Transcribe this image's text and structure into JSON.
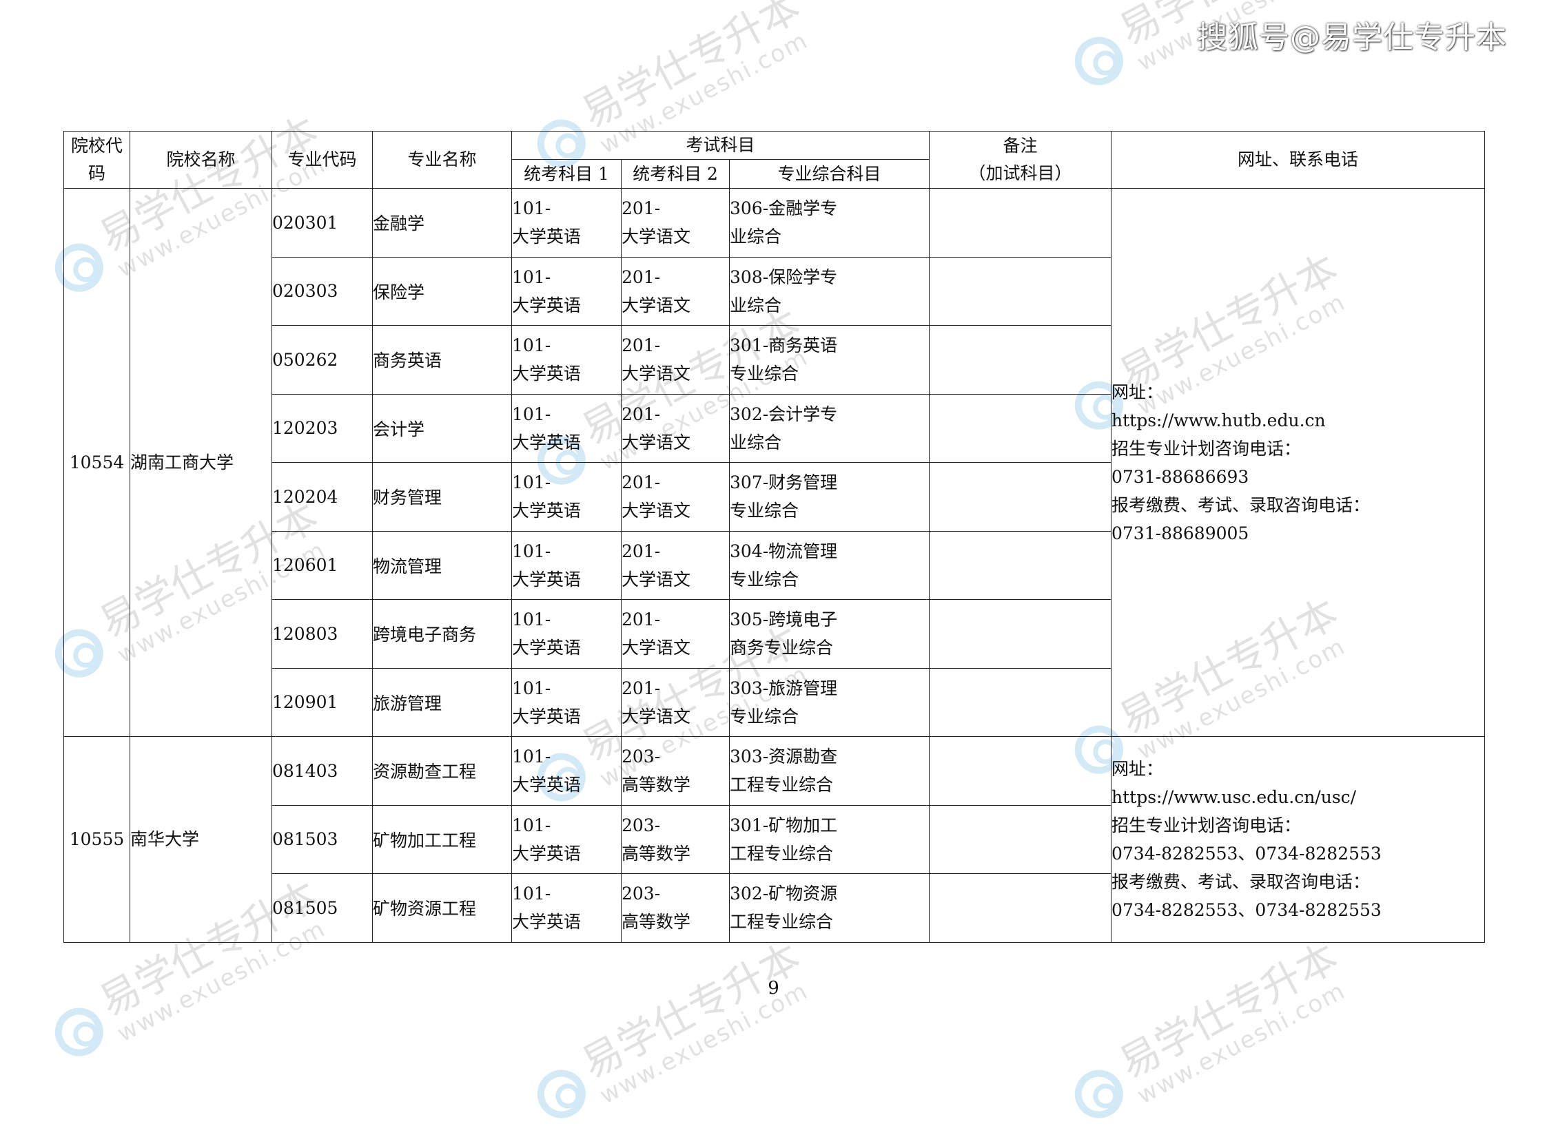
{
  "watermark": {
    "top_right": "搜狐号@易学仕专升本",
    "repeated_cn": "易学仕专升本",
    "repeated_url": "www.exueshi.com",
    "logo_color": "#3aa0d8"
  },
  "table": {
    "headers": {
      "school_code": "院校代码",
      "school_name": "院校名称",
      "major_code": "专业代码",
      "major_name": "专业名称",
      "exam_subjects": "考试科目",
      "subject1": "统考科目 1",
      "subject2": "统考科目 2",
      "subject3": "专业综合科目",
      "note": "备注（加试科目）",
      "note_line1": "备注",
      "note_line2": "（加试科目）",
      "contact": "网址、联系电话"
    },
    "schools": [
      {
        "code": "10554",
        "name": "湖南工商大学",
        "contact_lines": [
          "网址：",
          "https://www.hutb.edu.cn",
          "招生专业计划咨询电话：",
          "0731-88686693",
          "报考缴费、考试、录取咨询电话：",
          "0731-88689005"
        ],
        "majors": [
          {
            "code": "020301",
            "name": "金融学",
            "s1": "101-大学英语",
            "s2": "201-大学语文",
            "s3": "306-金融学专业综合",
            "note": ""
          },
          {
            "code": "020303",
            "name": "保险学",
            "s1": "101-大学英语",
            "s2": "201-大学语文",
            "s3": "308-保险学专业综合",
            "note": ""
          },
          {
            "code": "050262",
            "name": "商务英语",
            "s1": "101-大学英语",
            "s2": "201-大学语文",
            "s3": "301-商务英语专业综合",
            "note": ""
          },
          {
            "code": "120203",
            "name": "会计学",
            "s1": "101-大学英语",
            "s2": "201-大学语文",
            "s3": "302-会计学专业综合",
            "note": ""
          },
          {
            "code": "120204",
            "name": "财务管理",
            "s1": "101-大学英语",
            "s2": "201-大学语文",
            "s3": "307-财务管理专业综合",
            "note": ""
          },
          {
            "code": "120601",
            "name": "物流管理",
            "s1": "101-大学英语",
            "s2": "201-大学语文",
            "s3": "304-物流管理专业综合",
            "note": ""
          },
          {
            "code": "120803",
            "name": "跨境电子商务",
            "s1": "101-大学英语",
            "s2": "201-大学语文",
            "s3": "305-跨境电子商务专业综合",
            "note": ""
          },
          {
            "code": "120901",
            "name": "旅游管理",
            "s1": "101-大学英语",
            "s2": "201-大学语文",
            "s3": "303-旅游管理专业综合",
            "note": ""
          }
        ]
      },
      {
        "code": "10555",
        "name": "南华大学",
        "contact_lines": [
          "网址：",
          "https://www.usc.edu.cn/usc/",
          "招生专业计划咨询电话：",
          "0734-8282553、0734-8282553",
          "报考缴费、考试、录取咨询电话：",
          "0734-8282553、0734-8282553"
        ],
        "majors": [
          {
            "code": "081403",
            "name": "资源勘查工程",
            "s1": "101-大学英语",
            "s2": "203-高等数学",
            "s3": "303-资源勘查工程专业综合",
            "note": ""
          },
          {
            "code": "081503",
            "name": "矿物加工工程",
            "s1": "101-大学英语",
            "s2": "203-高等数学",
            "s3": "301-矿物加工工程专业综合",
            "note": ""
          },
          {
            "code": "081505",
            "name": "矿物资源工程",
            "s1": "101-大学英语",
            "s2": "203-高等数学",
            "s3": "302-矿物资源工程专业综合",
            "note": ""
          }
        ]
      }
    ]
  },
  "page_number": "9"
}
